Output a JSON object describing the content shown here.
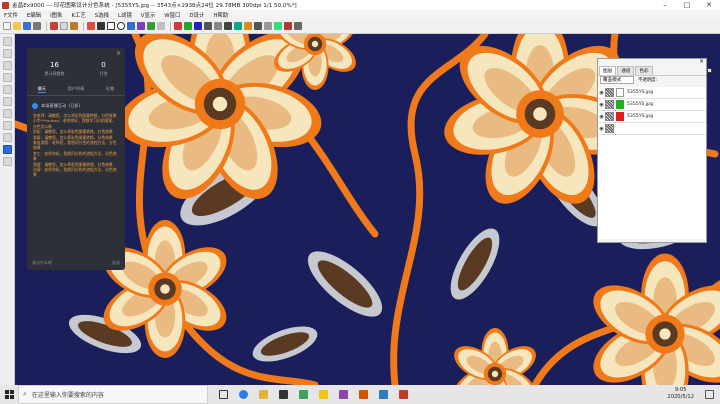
{
  "window": {
    "title": "金昌Ex9000 --- 印花图案设计分色系统 - [5355YS.jpg -- 3543点×2938点24位 29.78MB 300dpi 1/1 50.0%*]",
    "controls": [
      "–",
      "□",
      "✕"
    ]
  },
  "menu": [
    "F文件",
    "E编辑",
    "I图象",
    "K工艺",
    "S选择",
    "L滤镜",
    "V显示",
    "W窗口",
    "D设计",
    "H帮助"
  ],
  "dark_panel": {
    "close": "×",
    "stats": [
      {
        "value": "16",
        "label": "累计观看数"
      },
      {
        "value": "0",
        "label": "打赏"
      }
    ],
    "tabs": [
      "聊天",
      "用户列表",
      "礼物"
    ],
    "header": "本场直播互动（已折）",
    "messages": [
      "张老师：请教您，怎么将彩色图案转换，分色效果",
      "小华***wuhan：老师你好，我想学习印花图案，分色怎么做",
      "阿松：请教您，怎么将彩色图案转换，分色效果",
      "游客：请教您，怎么将彩色图案转换，分色效果",
      "来自游客：老师您，我想问分色的流程方法，分色效果",
      "李工：老师你好，我想问分色的流程方法，分色效果",
      "游客：请教您，怎么将彩色图案转换，分色效果",
      "访客：老师你好，我想问分色的流程方法，分色效果"
    ],
    "footer_left": "说点什么吧",
    "footer_right": "发送"
  },
  "layer_panel": {
    "close": "×",
    "tabs": [
      "图层",
      "通道",
      "色彩"
    ],
    "mode": "覆盖模式",
    "opacity": "不透明度:",
    "layers": [
      {
        "name": "5355YS.jpg",
        "color": "#ffffff"
      },
      {
        "name": "5355YS.jpg",
        "color": "#21b11f"
      },
      {
        "name": "5355YS.jpg",
        "color": "#e21b1b"
      },
      {
        "name": "",
        "color": "#0a3cf5"
      }
    ]
  },
  "taskbar": {
    "search_placeholder": "在这里输入你要搜索的内容",
    "time": "9:05",
    "date": "2020/5/12"
  },
  "colors": {
    "canvas_bg": "#1a1f5c",
    "orange": "#f07a1a",
    "cream": "#f6e6bd",
    "tan": "#e9bb82"
  }
}
